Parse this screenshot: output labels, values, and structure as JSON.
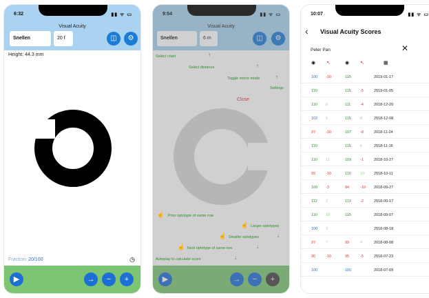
{
  "phone1": {
    "time": "6:32",
    "status_icons": "▮▮ ᯤ ▭",
    "nav_title": "Visual Acuity",
    "chart_field": "Snellen",
    "distance_field": "20 f",
    "height_label": "Height: 44.3 mm",
    "optotype_glyph": "C",
    "fraction_label": "Fraction:",
    "fraction_value": "20/100",
    "mirror_icon_glyph": "◫",
    "settings_icon_glyph": "⚙",
    "clock_icon_glyph": "◷",
    "buttons": {
      "play": "▶",
      "next": "→",
      "minus": "−",
      "plus": "+"
    }
  },
  "phone2": {
    "time": "9:54",
    "status_icons": "▮▮ ᯤ ▭",
    "nav_title": "Visual Acuity",
    "chart_field": "Snellen",
    "distance_field": "6 m",
    "mirror_icon_glyph": "◫",
    "settings_icon_glyph": "⚙",
    "optotype_glyph": "C",
    "hints": {
      "select_chart": "Select chart",
      "select_distance": "Select distance",
      "toggle_mirror": "Toggle mirror mode",
      "settings": "Settings",
      "close": "Close",
      "prior": "Prior optotype of same row",
      "larger": "Larger optotypes",
      "smaller": "Smaller optotypes",
      "next": "Next optotype of same row",
      "autoplay": "Autoplay to calculate score"
    },
    "arrows": {
      "up": "↑",
      "down": "↓"
    },
    "hand_glyph": "☝",
    "buttons": {
      "play": "▶",
      "next": "→",
      "minus": "−",
      "plus": "+"
    }
  },
  "phone3": {
    "time": "10:07",
    "status_icons": "▮▮ ᯤ ▭",
    "title": "Visual Acuity Scores",
    "back_glyph": "‹",
    "close_glyph": "✕",
    "patient": "Peter Pan",
    "header_icons": [
      "eye-icon",
      "pencil-icon",
      "eye-icon",
      "pencil-icon",
      "calendar-icon"
    ],
    "header_glyphs": [
      "◉",
      "↖",
      "◉",
      "↖",
      "▦"
    ],
    "rows": [
      {
        "r": "100",
        "rd": "-10",
        "l": "115",
        "ld": "",
        "date": "2019-01-17"
      },
      {
        "r": "110",
        "rd": "",
        "l": "115",
        "ld": "-5",
        "date": "2019-01-05"
      },
      {
        "r": "110",
        "rd": "6",
        "l": "111",
        "ld": "-4",
        "date": "2018-12-20"
      },
      {
        "r": "102",
        "rd": "5",
        "l": "115",
        "ld": "8",
        "date": "2018-12-08"
      },
      {
        "r": "97",
        "rd": "-10",
        "l": "107",
        "ld": "-8",
        "date": "2018-11-24"
      },
      {
        "r": "110",
        "rd": "",
        "l": "115",
        "ld": "6",
        "date": "2018-11-16"
      },
      {
        "r": "110",
        "rd": "11",
        "l": "109",
        "ld": "-1",
        "date": "2018-10-27"
      },
      {
        "r": "99",
        "rd": "-10",
        "l": "110",
        "ld": "10",
        "date": "2018-10-11"
      },
      {
        "r": "109",
        "rd": "-3",
        "l": "84",
        "ld": "-10",
        "date": "2018-09-27"
      },
      {
        "r": "112",
        "rd": "2",
        "l": "113",
        "ld": "-2",
        "date": "2018-09-17"
      },
      {
        "r": "110",
        "rd": "10",
        "l": "115",
        "ld": "",
        "date": "2018-09-07"
      },
      {
        "r": "100",
        "rd": "3",
        "l": "",
        "ld": "",
        "date": "2018-08-18"
      },
      {
        "r": "97",
        "rd": "7",
        "l": "99",
        "ld": "4",
        "date": "2018-08-08"
      },
      {
        "r": "90",
        "rd": "-10",
        "l": "95",
        "ld": "-5",
        "date": "2018-07-23"
      },
      {
        "r": "100",
        "rd": "",
        "l": "100",
        "ld": "",
        "date": "2018-07-09"
      }
    ]
  },
  "colors": {
    "nav": "#a9d3f0",
    "bottom": "#7cc673",
    "accent": "#1d6fd6",
    "positive": "#2e8b2e",
    "negative": "#d43a3a"
  }
}
